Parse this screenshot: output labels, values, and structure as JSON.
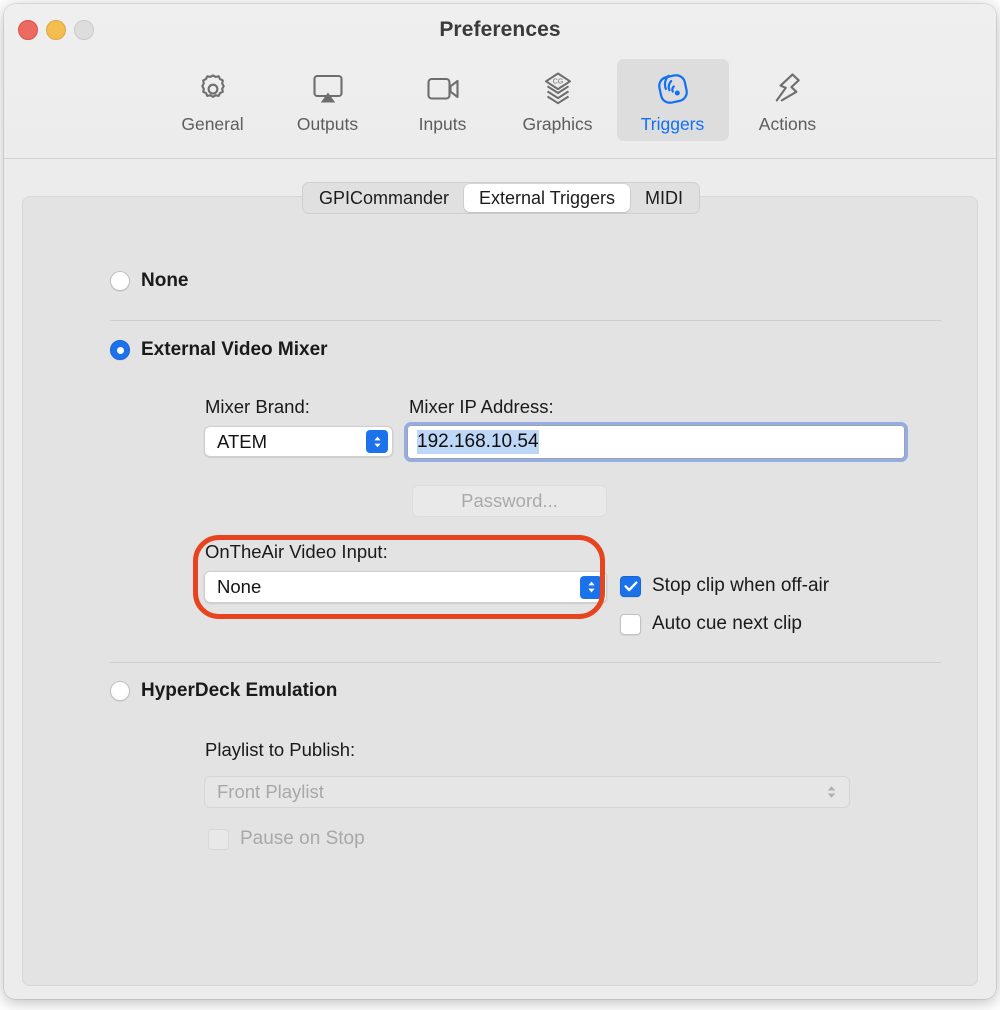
{
  "window": {
    "title": "Preferences",
    "traffic_lights": [
      {
        "name": "close",
        "color": "#ec6a5f"
      },
      {
        "name": "minimize",
        "color": "#f5bd4f"
      },
      {
        "name": "zoom",
        "color": "#dddddd"
      }
    ]
  },
  "toolbar": {
    "selected": "Triggers",
    "accent_color": "#1170f4",
    "items": [
      {
        "label": "General",
        "icon": "gear-icon"
      },
      {
        "label": "Outputs",
        "icon": "airplay-display-icon"
      },
      {
        "label": "Inputs",
        "icon": "video-camera-icon"
      },
      {
        "label": "Graphics",
        "icon": "layers-cg-icon"
      },
      {
        "label": "Triggers",
        "icon": "wireless-trigger-icon"
      },
      {
        "label": "Actions",
        "icon": "lightning-ribbon-icon"
      }
    ]
  },
  "tabs": {
    "selected": "External Triggers",
    "items": [
      {
        "label": "GPICommander"
      },
      {
        "label": "External Triggers"
      },
      {
        "label": "MIDI"
      }
    ]
  },
  "main": {
    "mode_options": [
      {
        "label": "None",
        "selected": false
      },
      {
        "label": "External Video Mixer",
        "selected": true
      },
      {
        "label": "HyperDeck Emulation",
        "selected": false
      }
    ],
    "external_video_mixer": {
      "mixer_brand_label": "Mixer Brand:",
      "mixer_brand_value": "ATEM",
      "mixer_ip_label": "Mixer IP Address:",
      "mixer_ip_value": "192.168.10.54",
      "password_button": "Password...",
      "password_enabled": false,
      "video_input_label": "OnTheAir Video Input:",
      "video_input_value": "None",
      "checkboxes": [
        {
          "label": "Stop clip when off-air",
          "checked": true,
          "enabled": true
        },
        {
          "label": "Auto cue next clip",
          "checked": false,
          "enabled": true
        }
      ]
    },
    "hyperdeck_emulation": {
      "playlist_label": "Playlist to Publish:",
      "playlist_value": "Front Playlist",
      "playlist_enabled": false,
      "pause_on_stop_label": "Pause on Stop",
      "pause_on_stop_checked": false,
      "pause_on_stop_enabled": false
    }
  },
  "annotation": {
    "shape": "rounded-rectangle",
    "color": "#e8431f",
    "targets": "OnTheAir Video Input: label and popup"
  }
}
